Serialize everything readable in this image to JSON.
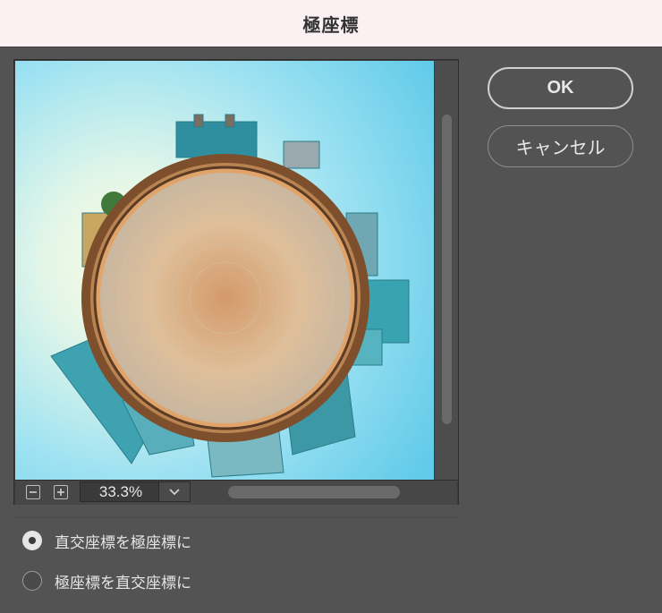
{
  "window": {
    "title": "極座標"
  },
  "preview": {
    "image": "little-planet-city-preview",
    "zoom_value": "33.3%",
    "zoom_out_icon": "minus-icon",
    "zoom_in_icon": "plus-icon",
    "dropdown_icon": "chevron-down-icon"
  },
  "buttons": {
    "ok": "OK",
    "cancel": "キャンセル"
  },
  "options": [
    {
      "label": "直交座標を極座標に",
      "selected": true
    },
    {
      "label": "極座標を直交座標に",
      "selected": false
    }
  ],
  "colors": {
    "sky": "#7fd8ef",
    "sun": "#fbf6d2",
    "dialog_bg": "#535353",
    "titlebar_bg": "#fbf0f2"
  }
}
